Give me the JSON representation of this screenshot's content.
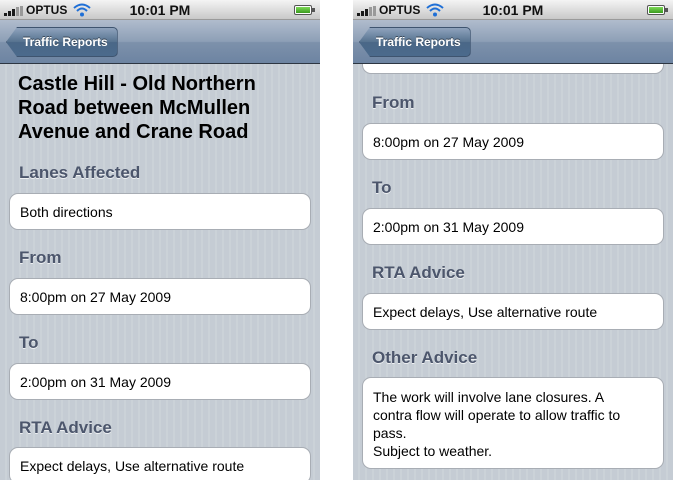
{
  "status_bar": {
    "carrier": "OPTUS",
    "time": "10:01 PM"
  },
  "nav": {
    "back_label": "Traffic Reports"
  },
  "left_screen": {
    "title_lines": [
      "Castle Hill - Old Northern",
      "Road  between McMullen",
      "Avenue and Crane Road"
    ],
    "sections": [
      {
        "header": "Lanes Affected",
        "value": "Both directions"
      },
      {
        "header": "From",
        "value": "8:00pm on 27 May 2009"
      },
      {
        "header": "To",
        "value": "2:00pm on 31 May 2009"
      },
      {
        "header": "RTA Advice",
        "value": "Expect delays, Use alternative route"
      }
    ]
  },
  "right_screen": {
    "sections": [
      {
        "header": "From",
        "value": "8:00pm on 27 May 2009"
      },
      {
        "header": "To",
        "value": "2:00pm on 31 May 2009"
      },
      {
        "header": "RTA Advice",
        "value": "Expect delays, Use alternative route"
      },
      {
        "header": "Other Advice",
        "lines": [
          "The work will involve lane closures. A",
          "contra flow will operate to allow traffic to",
          "pass.",
          "Subject to weather."
        ]
      }
    ]
  }
}
